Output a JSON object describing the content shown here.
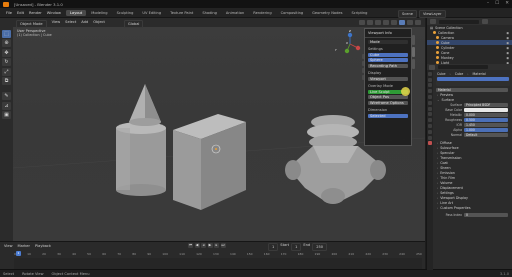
{
  "window": {
    "title": "[Unsaved] - Blender 3.1.0",
    "controls": [
      "–",
      "☐",
      "✕"
    ]
  },
  "menu": {
    "items": [
      "File",
      "Edit",
      "Render",
      "Window",
      "Help"
    ],
    "workspaces": [
      "Layout",
      "Modeling",
      "Sculpting",
      "UV Editing",
      "Texture Paint",
      "Shading",
      "Animation",
      "Rendering",
      "Compositing",
      "Geometry Nodes",
      "Scripting"
    ],
    "active_workspace": "Layout",
    "scene": "Scene",
    "view_layer": "ViewLayer"
  },
  "viewport": {
    "mode": "Object Mode",
    "menus": [
      "View",
      "Select",
      "Add",
      "Object"
    ],
    "transform": "Global",
    "label_top": "User Perspective",
    "label_sub": "(1) Collection | Cube",
    "axes": [
      "X",
      "Y",
      "Z"
    ]
  },
  "npanel": {
    "title": "Viewport Info",
    "sections": [
      "Settings",
      "Cube",
      "Sphere",
      "Recording Path",
      "Display",
      "Overlay Mode"
    ],
    "active_item": "Overlay Mode",
    "buttons": [
      "Mode",
      "Viewport",
      "Wireframe Options",
      "Selected"
    ],
    "mode_value": "Live Sculpt",
    "label_a": "Object Pos",
    "label_b": "Dimension"
  },
  "timeline": {
    "menus": [
      "View",
      "Marker",
      "Playback"
    ],
    "play_icons": [
      "⏮",
      "◀",
      "◂",
      "▶",
      "▸",
      "⏭"
    ],
    "start_label": "Start",
    "start": "1",
    "end_label": "End",
    "end": "250",
    "current": "1",
    "ruler": [
      "0",
      "10",
      "20",
      "30",
      "40",
      "50",
      "60",
      "70",
      "80",
      "90",
      "100",
      "110",
      "120",
      "130",
      "140",
      "150",
      "160",
      "170",
      "180",
      "190",
      "200",
      "210",
      "220",
      "230",
      "240",
      "250"
    ]
  },
  "statusbar": {
    "left": [
      "Select",
      "Rotate View",
      "Object Context Menu"
    ],
    "right": "3.1.0"
  },
  "outliner": {
    "title": "Scene Collection",
    "rows": [
      {
        "name": "Collection",
        "selected": false
      },
      {
        "name": "Camera",
        "selected": false
      },
      {
        "name": "Cube",
        "selected": true
      },
      {
        "name": "Cylinder",
        "selected": false
      },
      {
        "name": "Cone",
        "selected": false
      },
      {
        "name": "Monkey",
        "selected": false
      },
      {
        "name": "Light",
        "selected": false
      }
    ]
  },
  "properties": {
    "breadcrumb": [
      "Cube",
      "Cube",
      "Material"
    ],
    "material": "Material",
    "sections_top": [
      "Preview",
      "Surface"
    ],
    "fields": [
      {
        "label": "Surface",
        "value": "Principled BSDF",
        "style": "dark"
      },
      {
        "label": "Base Color",
        "value": "",
        "style": "white"
      },
      {
        "label": "Metallic",
        "value": "0.000",
        "style": "dark"
      },
      {
        "label": "Roughness",
        "value": "0.500",
        "style": "blue"
      },
      {
        "label": "IOR",
        "value": "1.450",
        "style": "dark"
      },
      {
        "label": "Alpha",
        "value": "1.000",
        "style": "blue"
      },
      {
        "label": "Normal",
        "value": "Default",
        "style": "dark"
      }
    ],
    "sections_bottom": [
      "Diffuse",
      "Subsurface",
      "Specular",
      "Transmission",
      "Coat",
      "Sheen",
      "Emission",
      "Thin Film",
      "Volume",
      "Displacement",
      "Settings",
      "Viewport Display",
      "Line Art",
      "Custom Properties"
    ],
    "footer_label": "Pass Index",
    "footer_value": "0"
  },
  "colors": {
    "accent": "#4d72c0",
    "selection": "#33466b",
    "green_bar": "#2e9a36",
    "object_orange": "#e8a03a"
  }
}
